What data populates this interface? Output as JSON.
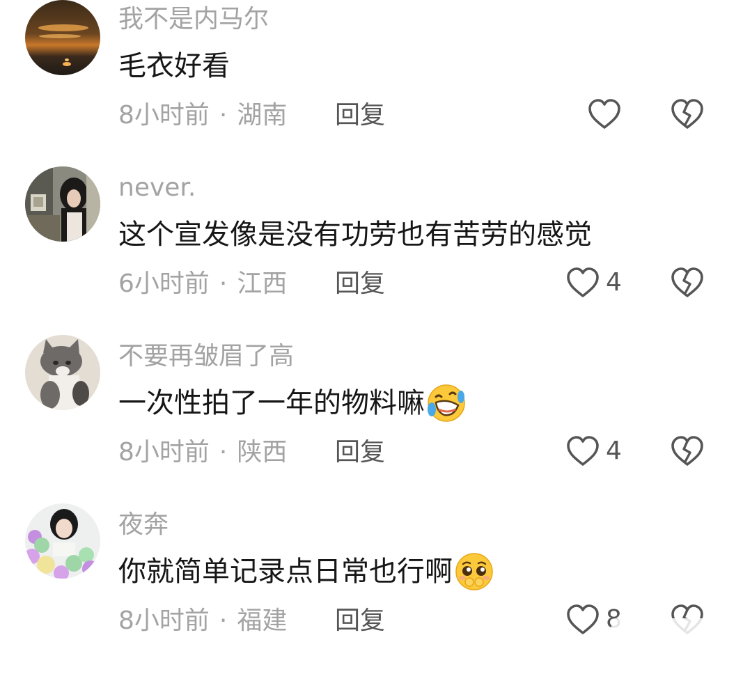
{
  "comments": [
    {
      "username": "我不是内马尔",
      "text": "毛衣好看",
      "time": "8小时前",
      "dot": "·",
      "location": "湖南",
      "reply_label": "回复",
      "likes": ""
    },
    {
      "username": "never.",
      "text": "这个宣发像是没有功劳也有苦劳的感觉",
      "time": "6小时前",
      "dot": "·",
      "location": "江西",
      "reply_label": "回复",
      "likes": "4"
    },
    {
      "username": "不要再皱眉了高",
      "text": "一次性拍了一年的物料嘛",
      "time": "8小时前",
      "dot": "·",
      "location": "陕西",
      "reply_label": "回复",
      "likes": "4",
      "emoji": "rolling-laughing-emoji"
    },
    {
      "username": "夜奔",
      "text": "你就简单记录点日常也行啊",
      "time": "8小时前",
      "dot": "·",
      "location": "福建",
      "reply_label": "回复",
      "likes": "8",
      "emoji": "pleading-face-emoji"
    }
  ],
  "icons": {
    "like": "heart-outline-icon",
    "dislike": "broken-heart-icon"
  },
  "colors": {
    "secondary_text": "#a3a3a3",
    "primary_text": "#161616",
    "icon": "#555555"
  }
}
